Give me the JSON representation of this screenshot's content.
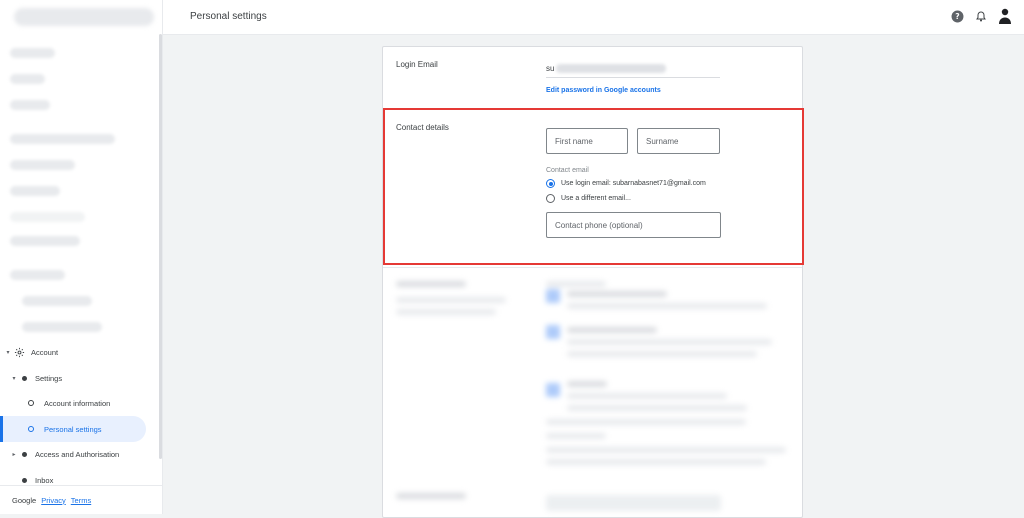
{
  "header": {
    "title": "Personal settings",
    "help_icon": "help-circle-icon",
    "bell_icon": "bell-icon",
    "avatar_icon": "avatar-icon"
  },
  "sidebar": {
    "items": [
      {
        "label": "Account",
        "icon": "gear-icon"
      },
      {
        "label": "Settings"
      },
      {
        "label": "Account information"
      },
      {
        "label": "Personal settings"
      },
      {
        "label": "Access and Authorisation"
      },
      {
        "label": "Inbox"
      }
    ],
    "footer": {
      "brand": "Google",
      "privacy": "Privacy",
      "terms": "Terms"
    }
  },
  "login": {
    "label": "Login Email",
    "value_prefix": "su",
    "edit_link": "Edit password in Google accounts"
  },
  "contact": {
    "label": "Contact details",
    "first_name_placeholder": "First name",
    "surname_placeholder": "Surname",
    "contact_email_label": "Contact email",
    "radio_login": "Use login email: subarnabasnet71@gmail.com",
    "radio_different": "Use a different email...",
    "phone_placeholder": "Contact phone (optional)"
  },
  "colors": {
    "accent": "#1a73e8",
    "highlight": "#e53935"
  }
}
